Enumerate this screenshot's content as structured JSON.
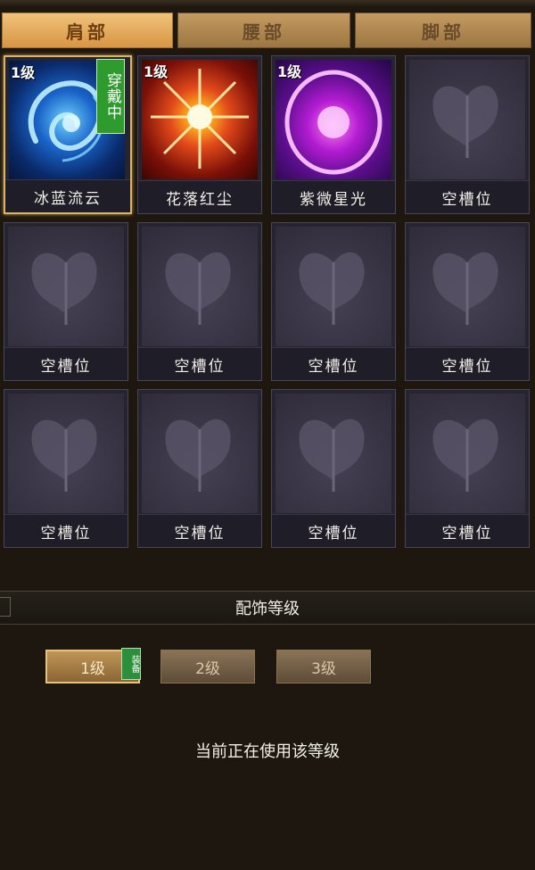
{
  "tabs": [
    {
      "label": "肩部",
      "active": true
    },
    {
      "label": "腰部",
      "active": false
    },
    {
      "label": "脚部",
      "active": false
    }
  ],
  "slots": [
    {
      "name": "冰蓝流云",
      "level": "1级",
      "wearing": "穿戴中",
      "icon": "blue-swirl-icon"
    },
    {
      "name": "花落红尘",
      "level": "1级",
      "icon": "red-starburst-icon"
    },
    {
      "name": "紫微星光",
      "level": "1级",
      "icon": "purple-orb-icon"
    },
    {
      "name": "空槽位",
      "icon": "butterfly-icon"
    },
    {
      "name": "空槽位",
      "icon": "butterfly-icon"
    },
    {
      "name": "空槽位",
      "icon": "butterfly-icon"
    },
    {
      "name": "空槽位",
      "icon": "butterfly-icon"
    },
    {
      "name": "空槽位",
      "icon": "butterfly-icon"
    },
    {
      "name": "空槽位",
      "icon": "butterfly-icon"
    },
    {
      "name": "空槽位",
      "icon": "butterfly-icon"
    },
    {
      "name": "空槽位",
      "icon": "butterfly-icon"
    },
    {
      "name": "空槽位",
      "icon": "butterfly-icon"
    }
  ],
  "section_title": "配饰等级",
  "level_buttons": [
    {
      "label": "1级",
      "active": true
    },
    {
      "label": "2级",
      "active": false
    },
    {
      "label": "3级",
      "active": false
    }
  ],
  "equip_tag": "装备",
  "status_text": "当前正在使用该等级",
  "colors": {
    "background": "#1d1710",
    "tab_active": "#e0a55a",
    "selected_border": "#d9b46a",
    "badge_green": "#2e9b2e"
  }
}
